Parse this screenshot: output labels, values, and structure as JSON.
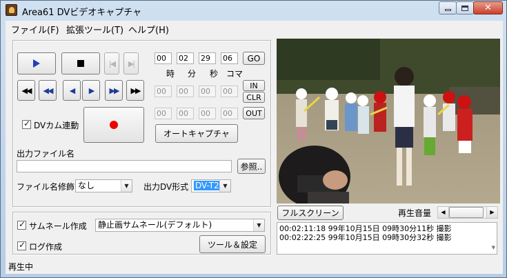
{
  "window": {
    "title": "Area61 DVビデオキャプチャ"
  },
  "menu": [
    "ファイル(F)",
    "拡張ツール(T)",
    "ヘルプ(H)"
  ],
  "transport": {
    "row1": [
      "play-icon",
      "stop-icon",
      "prev-frame-icon",
      "next-frame-icon"
    ],
    "row2": [
      "fast-rewind-icon",
      "rewind-icon",
      "step-back-icon",
      "step-forward-icon",
      "forward-icon",
      "fast-forward-icon"
    ]
  },
  "timecode": {
    "values": [
      "00",
      "02",
      "29",
      "06"
    ],
    "units": [
      "時",
      "分",
      "秒",
      "コマ"
    ],
    "go_label": "GO",
    "in_values": [
      "00",
      "00",
      "00",
      "00"
    ],
    "out_values": [
      "00",
      "00",
      "00",
      "00"
    ],
    "in_label": "IN",
    "clr_label": "CLR",
    "out_label": "OUT"
  },
  "capture": {
    "dv_cam_label": "DVカム連動",
    "dv_cam_checked": true,
    "auto_capture_label": "オートキャプチャ"
  },
  "output": {
    "filename_label": "出力ファイル名",
    "filename_value": "",
    "browse_label": "参照..",
    "modifier_label": "ファイル名修飾",
    "modifier_value": "なし",
    "dv_format_label": "出力DV形式",
    "dv_format_value": "DV-T2"
  },
  "options": {
    "thumbnail_label": "サムネール作成",
    "thumbnail_checked": true,
    "thumbnail_mode": "静止画サムネール(デフォルト)",
    "log_label": "ログ作成",
    "log_checked": true,
    "tools_label": "ツール＆設定"
  },
  "playback": {
    "fullscreen_label": "フルスクリーン",
    "volume_label": "再生音量",
    "volume_level": 0.0
  },
  "log": [
    "00:02:11:18 99年10月15日  09時30分11秒 撮影",
    "00:02:22:25 99年10月15日  09時30分32秒 撮影"
  ],
  "status": {
    "text": "再生中"
  }
}
